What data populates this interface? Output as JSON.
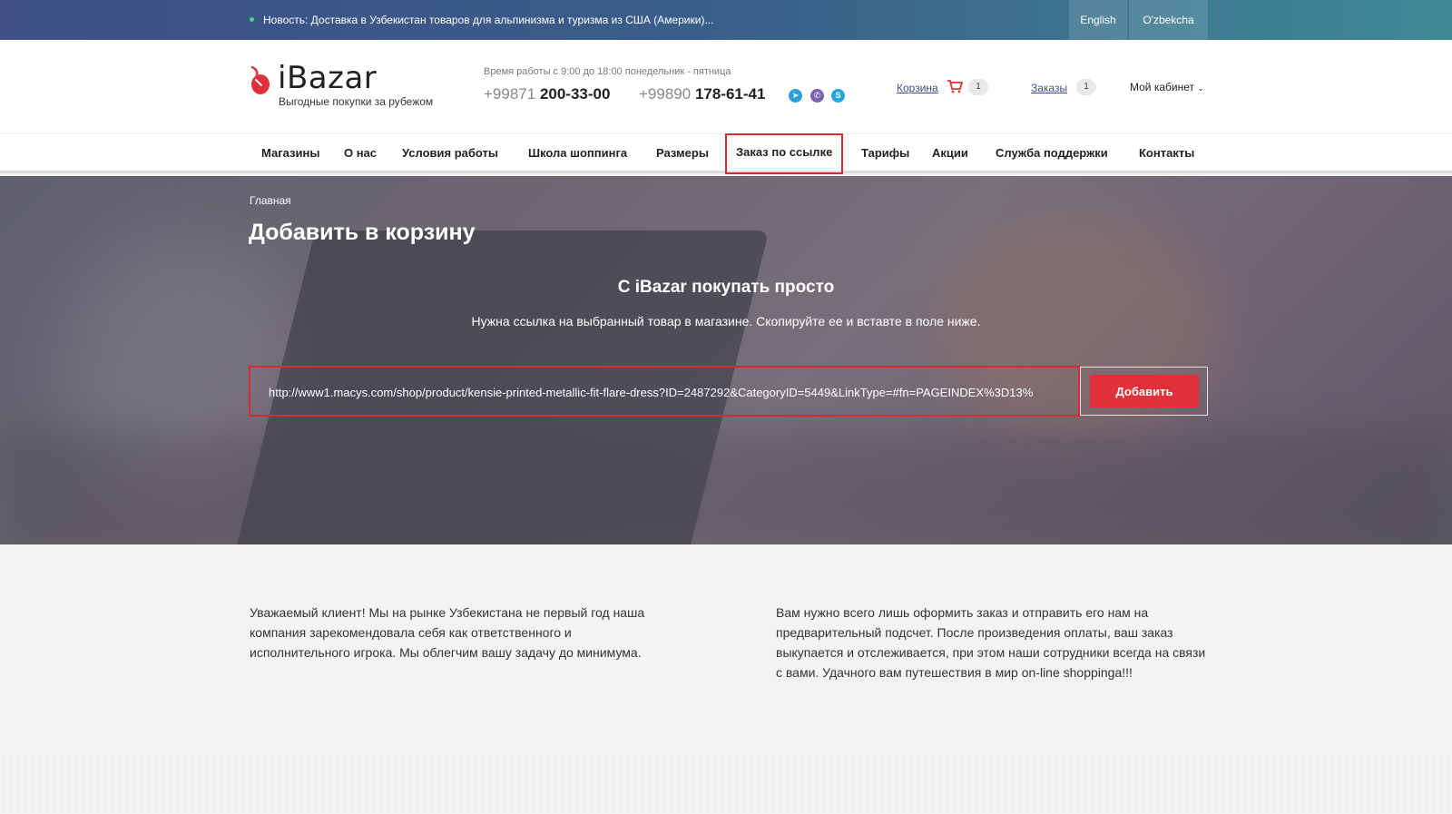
{
  "topbar": {
    "news": "Новость: Доставка в Узбекистан товаров для альпинизма и туризма из США (Америки)...",
    "languages": [
      "English",
      "O'zbekcha"
    ]
  },
  "header": {
    "logo_text": "iBazar",
    "logo_subtitle": "Выгодные покупки за рубежом",
    "work_hours": "Время работы с 9:00 до 18:00 понедельник - пятница",
    "phones": [
      {
        "code": "+99871",
        "number": "200-33-00"
      },
      {
        "code": "+99890",
        "number": "178-61-41"
      }
    ],
    "messengers": [
      "telegram-icon",
      "viber-icon",
      "skype-icon"
    ],
    "cart_label": "Корзина",
    "cart_count": "1",
    "orders_label": "Заказы",
    "orders_count": "1",
    "cabinet_label": "Мой кабинет"
  },
  "nav": {
    "items": [
      "Магазины",
      "О нас",
      "Условия работы",
      "Школа шоппинга",
      "Размеры",
      "Заказ по ссылке",
      "Тарифы",
      "Акции",
      "Служба поддержки",
      "Контакты"
    ],
    "active": "Заказ по ссылке"
  },
  "hero": {
    "breadcrumb": "Главная",
    "title": "Добавить в корзину",
    "heading": "С iBazar покупать просто",
    "subheading": "Нужна ссылка на выбранный товар в магазине. Скопируйте ее и вставте в поле ниже.",
    "url_value": "http://www1.macys.com/shop/product/kensie-printed-metallic-fit-flare-dress?ID=2487292&CategoryID=5449&LinkType=#fn=PAGEINDEX%3D13%",
    "add_button": "Добавить"
  },
  "content": {
    "left_text": "Уважаемый клиент! Мы на рынке Узбекистана не первый год наша компания зарекомендовала себя как ответственного и исполнительного игрока. Мы облегчим вашу задачу до минимума.",
    "right_text": "Вам нужно всего лишь оформить заказ и отправить его нам на предварительный подсчет. После произведения оплаты, ваш заказ выкупается и отслеживается, при этом наши сотрудники всегда на связи с вами. Удачного вам путешествия в мир on-line shoppinga!!!"
  },
  "colors": {
    "accent": "#e0303a",
    "topbar_start": "#3d4f86",
    "topbar_end": "#3f8a95",
    "link": "#3b4f8a"
  }
}
